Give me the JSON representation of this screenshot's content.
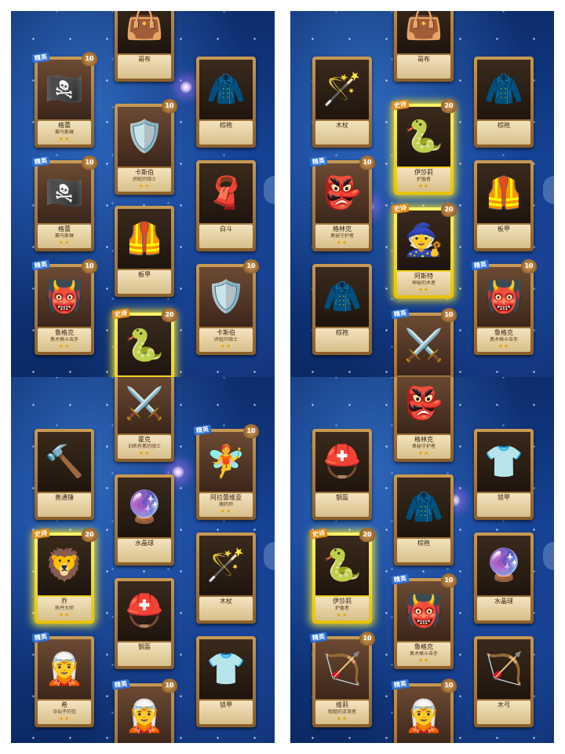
{
  "panels": [
    {
      "cards": [
        {
          "kind": "item",
          "name": "哥布",
          "stars": ""
        },
        {
          "kind": "hero",
          "rarity": "精英",
          "level": "10",
          "name": "格蕾",
          "sub": "赛马斯琳",
          "stars": "★★"
        },
        {
          "kind": "hero",
          "rarity": "",
          "level": "10",
          "name": "卡斯伯",
          "sub": "肝脏的骑士",
          "stars": "★★"
        },
        {
          "kind": "item",
          "name": "棕袍",
          "stars": ""
        },
        {
          "kind": "hero",
          "rarity": "精英",
          "level": "10",
          "name": "格蕾",
          "sub": "赛马斯琳",
          "stars": "★★"
        },
        {
          "kind": "item",
          "name": "白斗",
          "stars": ""
        },
        {
          "kind": "item",
          "name": "板甲",
          "stars": ""
        },
        {
          "kind": "hero",
          "rarity": "精英",
          "level": "10",
          "name": "鲁格克",
          "sub": "奥术格斗击手",
          "stars": "★★"
        },
        {
          "kind": "hero",
          "rarity": "",
          "level": "10",
          "name": "卡斯伯",
          "sub": "肝脏的骑士",
          "stars": "★★"
        },
        {
          "kind": "legend",
          "rarity": "史诗",
          "level": "20",
          "name": "",
          "sub": "",
          "stars": ""
        }
      ]
    },
    {
      "cards": [
        {
          "kind": "item",
          "name": "哥布",
          "stars": ""
        },
        {
          "kind": "item",
          "name": "木杖",
          "stars": ""
        },
        {
          "kind": "legend",
          "rarity": "史诗",
          "level": "20",
          "name": "伊莎莉",
          "sub": "护盾者",
          "stars": "★★"
        },
        {
          "kind": "item",
          "name": "棕袍",
          "stars": ""
        },
        {
          "kind": "hero",
          "rarity": "精英",
          "level": "10",
          "name": "格林克",
          "sub": "奥秘守护者",
          "stars": "★★"
        },
        {
          "kind": "legend",
          "rarity": "史诗",
          "level": "20",
          "name": "阿斯特",
          "sub": "神秘的术者",
          "stars": "★★"
        },
        {
          "kind": "item",
          "name": "板甲",
          "stars": ""
        },
        {
          "kind": "item",
          "name": "棕袍",
          "stars": ""
        },
        {
          "kind": "hero",
          "rarity": "精英",
          "level": "10",
          "name": "鲁格克",
          "sub": "奥术格斗击手",
          "stars": "★★"
        },
        {
          "kind": "hero",
          "rarity": "精英",
          "level": "10",
          "name": "",
          "sub": "",
          "stars": ""
        }
      ]
    },
    {
      "cards": [
        {
          "kind": "hero",
          "rarity": "",
          "level": "",
          "name": "霍克",
          "sub": "训练有素的骑士",
          "stars": "★★"
        },
        {
          "kind": "item",
          "name": "普通锤",
          "stars": ""
        },
        {
          "kind": "item",
          "name": "水晶球",
          "stars": ""
        },
        {
          "kind": "hero",
          "rarity": "精英",
          "level": "10",
          "name": "阿拉蕾维亚",
          "sub": "魔药师",
          "stars": "★★"
        },
        {
          "kind": "legend",
          "rarity": "史诗",
          "level": "20",
          "name": "乔",
          "sub": "炼丹大师",
          "stars": "★★"
        },
        {
          "kind": "item",
          "name": "木杖",
          "stars": ""
        },
        {
          "kind": "item",
          "name": "钢盔",
          "stars": ""
        },
        {
          "kind": "hero",
          "rarity": "精英",
          "level": "",
          "name": "希",
          "sub": "寻仙子的信",
          "stars": "★★"
        },
        {
          "kind": "item",
          "name": "锁甲",
          "stars": ""
        },
        {
          "kind": "hero",
          "rarity": "精英",
          "level": "10",
          "name": "",
          "sub": "",
          "stars": ""
        }
      ]
    },
    {
      "cards": [
        {
          "kind": "hero",
          "rarity": "",
          "level": "",
          "name": "格林克",
          "sub": "奥秘守护者",
          "stars": "★★"
        },
        {
          "kind": "item",
          "name": "钢盔",
          "stars": ""
        },
        {
          "kind": "item",
          "name": "锁甲",
          "stars": ""
        },
        {
          "kind": "item",
          "name": "棕袍",
          "stars": ""
        },
        {
          "kind": "legend",
          "rarity": "史诗",
          "level": "20",
          "name": "伊莎莉",
          "sub": "护盾者",
          "stars": "★★"
        },
        {
          "kind": "item",
          "name": "水晶球",
          "stars": ""
        },
        {
          "kind": "hero",
          "rarity": "精英",
          "level": "10",
          "name": "鲁格克",
          "sub": "奥术格斗击手",
          "stars": "★★"
        },
        {
          "kind": "hero",
          "rarity": "精英",
          "level": "10",
          "name": "维莉",
          "sub": "粗糙的流浪者",
          "stars": "★★"
        },
        {
          "kind": "item",
          "name": "木弓",
          "stars": ""
        },
        {
          "kind": "hero",
          "rarity": "精英",
          "level": "10",
          "name": "",
          "sub": "",
          "stars": ""
        }
      ]
    }
  ]
}
